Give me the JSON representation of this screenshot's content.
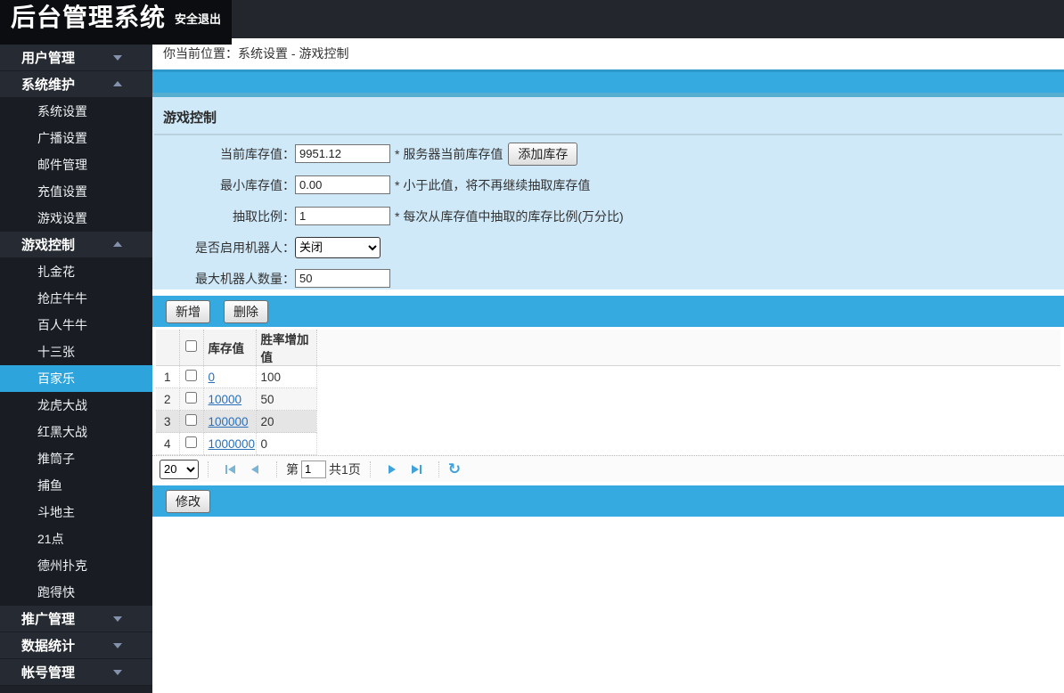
{
  "header": {
    "title": "后台管理系统",
    "logout_label": "安全退出"
  },
  "breadcrumb": {
    "text": "你当前位置：系统设置 - 游戏控制"
  },
  "sidebar": {
    "items": [
      {
        "label": "用户管理",
        "type": "parent",
        "state": "collapsed"
      },
      {
        "label": "系统维护",
        "type": "parent",
        "state": "expanded"
      },
      {
        "label": "系统设置",
        "type": "sub"
      },
      {
        "label": "广播设置",
        "type": "sub"
      },
      {
        "label": "邮件管理",
        "type": "sub"
      },
      {
        "label": "充值设置",
        "type": "sub"
      },
      {
        "label": "游戏设置",
        "type": "sub"
      },
      {
        "label": "游戏控制",
        "type": "parent",
        "state": "expanded"
      },
      {
        "label": "扎金花",
        "type": "sub"
      },
      {
        "label": "抢庄牛牛",
        "type": "sub"
      },
      {
        "label": "百人牛牛",
        "type": "sub"
      },
      {
        "label": "十三张",
        "type": "sub"
      },
      {
        "label": "百家乐",
        "type": "sub",
        "selected": true
      },
      {
        "label": "龙虎大战",
        "type": "sub"
      },
      {
        "label": "红黑大战",
        "type": "sub"
      },
      {
        "label": "推筒子",
        "type": "sub"
      },
      {
        "label": "捕鱼",
        "type": "sub"
      },
      {
        "label": "斗地主",
        "type": "sub"
      },
      {
        "label": "21点",
        "type": "sub"
      },
      {
        "label": "德州扑克",
        "type": "sub"
      },
      {
        "label": "跑得快",
        "type": "sub"
      },
      {
        "label": "推广管理",
        "type": "parent",
        "state": "collapsed"
      },
      {
        "label": "数据统计",
        "type": "parent",
        "state": "collapsed"
      },
      {
        "label": "帐号管理",
        "type": "parent",
        "state": "collapsed"
      }
    ]
  },
  "panel": {
    "title": "游戏控制",
    "fields": {
      "current_stock": {
        "label": "当前库存值：",
        "value": "9951.12",
        "hint": "* 服务器当前库存值",
        "button_label": "添加库存"
      },
      "min_stock": {
        "label": "最小库存值：",
        "value": "0.00",
        "hint": "* 小于此值，将不再继续抽取库存值"
      },
      "draw_ratio": {
        "label": "抽取比例：",
        "value": "1",
        "hint": "* 每次从库存值中抽取的库存比例(万分比)"
      },
      "robot": {
        "label": "是否启用机器人：",
        "value": "关闭"
      },
      "max_robots": {
        "label": "最大机器人数量：",
        "value": "50"
      }
    }
  },
  "toolbar": {
    "add_label": "新增",
    "delete_label": "删除"
  },
  "table": {
    "headers": {
      "stock": "库存值",
      "win_rate": "胜率增加值"
    },
    "rows": [
      {
        "index": "1",
        "stock": "0",
        "win_rate": "100"
      },
      {
        "index": "2",
        "stock": "10000",
        "win_rate": "50"
      },
      {
        "index": "3",
        "stock": "100000",
        "win_rate": "20"
      },
      {
        "index": "4",
        "stock": "1000000",
        "win_rate": "0"
      }
    ]
  },
  "pagination": {
    "page_size": "20",
    "page_prefix": "第",
    "current_page": "1",
    "total_pages_label": "共1页",
    "refresh_icon": "↻"
  },
  "footer": {
    "modify_label": "修改"
  },
  "colors": {
    "accent_blue": "#34aae1",
    "panel_blue": "#cfe9f8",
    "sidebar_dark": "#1e2127",
    "selected_blue": "#2ea4dd",
    "link_blue": "#2970ba"
  }
}
